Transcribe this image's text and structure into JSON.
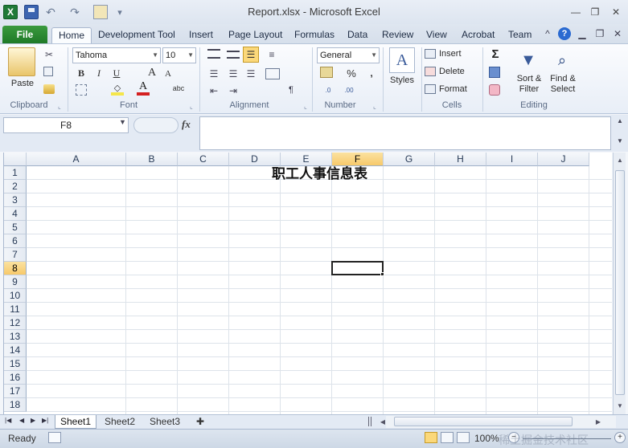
{
  "window": {
    "title": "Report.xlsx  -  Microsoft Excel",
    "app_badge": "X",
    "undo_glyph": "↶",
    "redo_glyph": "↷",
    "qa_menu_glyph": "▾",
    "minimize": "—",
    "restore": "❐",
    "close": "✕"
  },
  "ribbon_tabs": [
    "File",
    "Home",
    "Development Tool",
    "Insert",
    "Page Layout",
    "Formulas",
    "Data",
    "Review",
    "View",
    "Acrobat",
    "Team"
  ],
  "ribbon": {
    "clipboard": {
      "label": "Clipboard",
      "paste": "Paste"
    },
    "font": {
      "label": "Font",
      "family": "Tahoma",
      "size": "10",
      "bold": "B",
      "italic": "I",
      "underline": "U",
      "grow": "A",
      "shrink": "A",
      "font_color": "A",
      "phonetic": "abc"
    },
    "alignment": {
      "label": "Alignment"
    },
    "number": {
      "label": "Number",
      "format": "General",
      "percent": "%",
      "comma": ","
    },
    "styles": {
      "label": "Styles"
    },
    "cells": {
      "label": "Cells",
      "insert": "Insert",
      "delete": "Delete",
      "format": "Format"
    },
    "editing": {
      "label": "Editing",
      "sort_filter": "Sort & Filter",
      "find_select": "Find & Select",
      "sum": "Σ"
    }
  },
  "formula_bar": {
    "name_box": "F8",
    "fx": "fx",
    "content": ""
  },
  "grid": {
    "columns": [
      "A",
      "B",
      "C",
      "D",
      "E",
      "F",
      "G",
      "H",
      "I",
      "J"
    ],
    "rows": [
      "1",
      "2",
      "3",
      "4",
      "5",
      "6",
      "7",
      "8",
      "9",
      "10",
      "11",
      "12",
      "13",
      "14",
      "15",
      "16",
      "17",
      "18"
    ],
    "selected_column": "F",
    "selected_row": "8",
    "title_cell": "职工人事信息表"
  },
  "sheets": [
    "Sheet1",
    "Sheet2",
    "Sheet3"
  ],
  "status": {
    "ready": "Ready",
    "zoom": "100%",
    "watermark": "稀土掘金技术社区"
  },
  "colors": {
    "excel_green": "#1f7a38",
    "selection_gold": "#f7c96a",
    "ribbon_blue": "#dfe6f0"
  }
}
